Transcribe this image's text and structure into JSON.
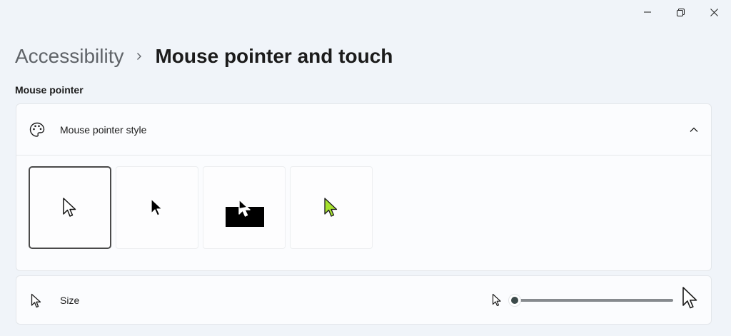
{
  "window": {
    "minimize_icon": "minimize-icon",
    "maximize_icon": "restore-icon",
    "close_icon": "close-icon"
  },
  "breadcrumb": {
    "parent": "Accessibility",
    "separator_icon": "chevron-right-icon",
    "current": "Mouse pointer and touch"
  },
  "section": {
    "title": "Mouse pointer"
  },
  "pointer_style": {
    "label": "Mouse pointer style",
    "icon": "palette-icon",
    "expanded": true,
    "options": [
      {
        "name": "white",
        "icon": "cursor-white-icon",
        "selected": true
      },
      {
        "name": "black",
        "icon": "cursor-black-icon",
        "selected": false
      },
      {
        "name": "inverted",
        "icon": "cursor-inverted-icon",
        "selected": false
      },
      {
        "name": "custom",
        "icon": "cursor-custom-icon",
        "selected": false,
        "color": "#a6e22e"
      }
    ]
  },
  "size": {
    "label": "Size",
    "icon": "cursor-size-icon",
    "slider_value": 0,
    "slider_min_icon": "cursor-small-icon",
    "slider_max_icon": "cursor-large-icon"
  },
  "colors": {
    "background": "#f0f4f9",
    "card": "#fbfcfe",
    "accent_custom": "#a6e22e",
    "slider_track": "#868a8e"
  }
}
